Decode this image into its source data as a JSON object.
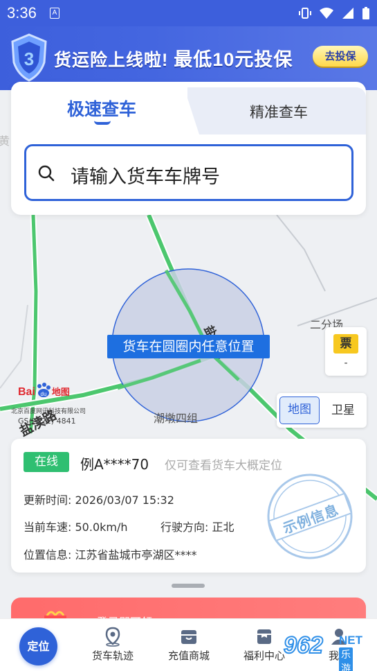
{
  "status_bar": {
    "time": "3:36",
    "notification_glyph": "A"
  },
  "banner": {
    "text_part1": "货运险上线啦!",
    "text_part2": "最低10元投保",
    "cta": "去投保"
  },
  "search_card": {
    "tab_active": "极速查车",
    "tab_inactive": "精准查车",
    "placeholder": "请输入货车车牌号"
  },
  "map": {
    "circle_label": "货车在圆圈内任意位置",
    "places": {
      "erfenchang": "二分场",
      "chaodun": "潮墩四组",
      "huang": "黄"
    },
    "roads": {
      "left_road": "盐渎路",
      "center_road": "盐淮路"
    },
    "ticket_badge": "票",
    "ticket_sub": "-",
    "toggle_map": "地图",
    "toggle_satellite": "卫星",
    "baidu_logo_bai": "Bai",
    "baidu_logo_du": "du",
    "baidu_logo_ditu": "地图",
    "copyright_line1": "北京百度网讯科技有限公司",
    "copyright_line2": "GS(2021) 4841"
  },
  "vehicle": {
    "status": "在线",
    "plate": "例A****70",
    "note": "仅可查看货车大概定位",
    "update_label": "更新时间:",
    "update_value": "2026/03/07 15:32",
    "speed_label": "当前车速:",
    "speed_value": "50.0km/h",
    "direction_label": "行驶方向:",
    "direction_value": "正北",
    "location_label": "位置信息:",
    "location_value": "江苏省盐城市亭湖区****",
    "stamp_text": "示例信息"
  },
  "promo_strip": {
    "text": "登录即可领"
  },
  "bottom_nav": {
    "locate": "定位",
    "items": [
      {
        "label": "货车轨迹",
        "icon": "location-pin-icon"
      },
      {
        "label": "充值商城",
        "icon": "shop-icon"
      },
      {
        "label": "福利中心",
        "icon": "gift-bag-icon"
      },
      {
        "label": "我的",
        "icon": "user-icon"
      }
    ]
  },
  "watermark": {
    "number": "962",
    "net": "NET",
    "sub": "乐游网"
  },
  "colors": {
    "accent": "#2f62d8",
    "banner": "#3d5fdc",
    "online": "#2fbf71",
    "road": "#4cc76e",
    "circle_fill": "#c9d0e4",
    "promo_red": "#ff6b6b"
  }
}
